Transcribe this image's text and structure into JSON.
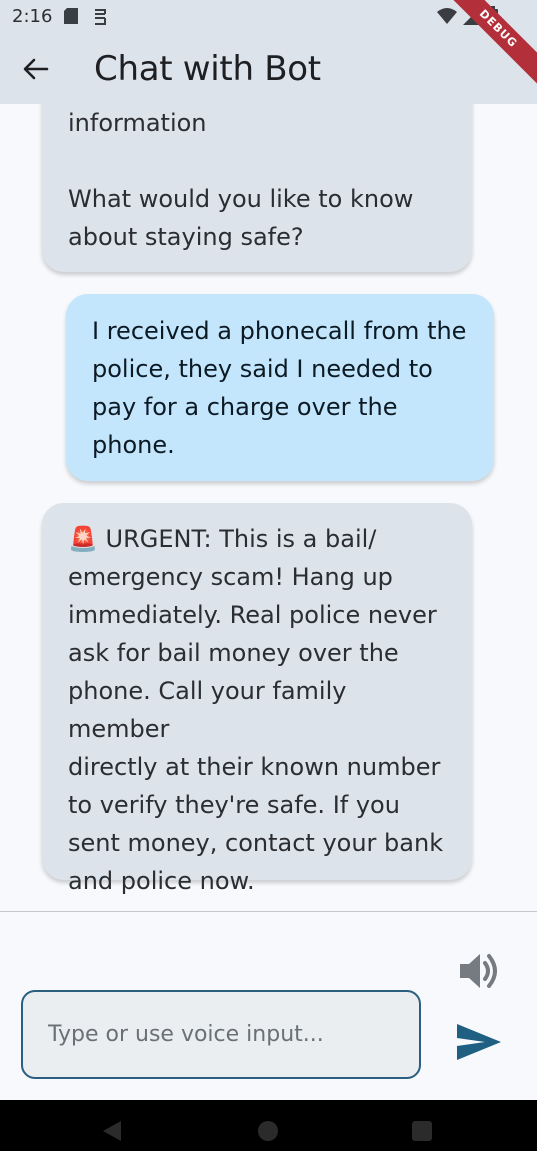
{
  "status_bar": {
    "time": "2:16"
  },
  "debug_banner": "DEBUG",
  "app_bar": {
    "title": "Chat with Bot"
  },
  "messages": [
    {
      "role": "bot",
      "text": "information\n\nWhat would you like to know\nabout staying safe?"
    },
    {
      "role": "user",
      "text": "I received a phonecall from the\npolice, they said I needed to\npay for a charge over the\nphone."
    },
    {
      "role": "bot",
      "text": "🚨 URGENT: This is a bail/\nemergency scam! Hang up\nimmediately. Real police never\nask for bail money over the\nphone. Call your family member\ndirectly at their known number\nto verify they're safe. If you\nsent money, contact your bank\nand police now."
    }
  ],
  "composer": {
    "placeholder": "Type or use voice input...",
    "value": ""
  },
  "colors": {
    "app_bar": "#dde3ea",
    "user_bubble": "#c3e6fd",
    "bot_bubble": "#dde3ea",
    "accent": "#2b5f7f",
    "send": "#1e5f82"
  }
}
